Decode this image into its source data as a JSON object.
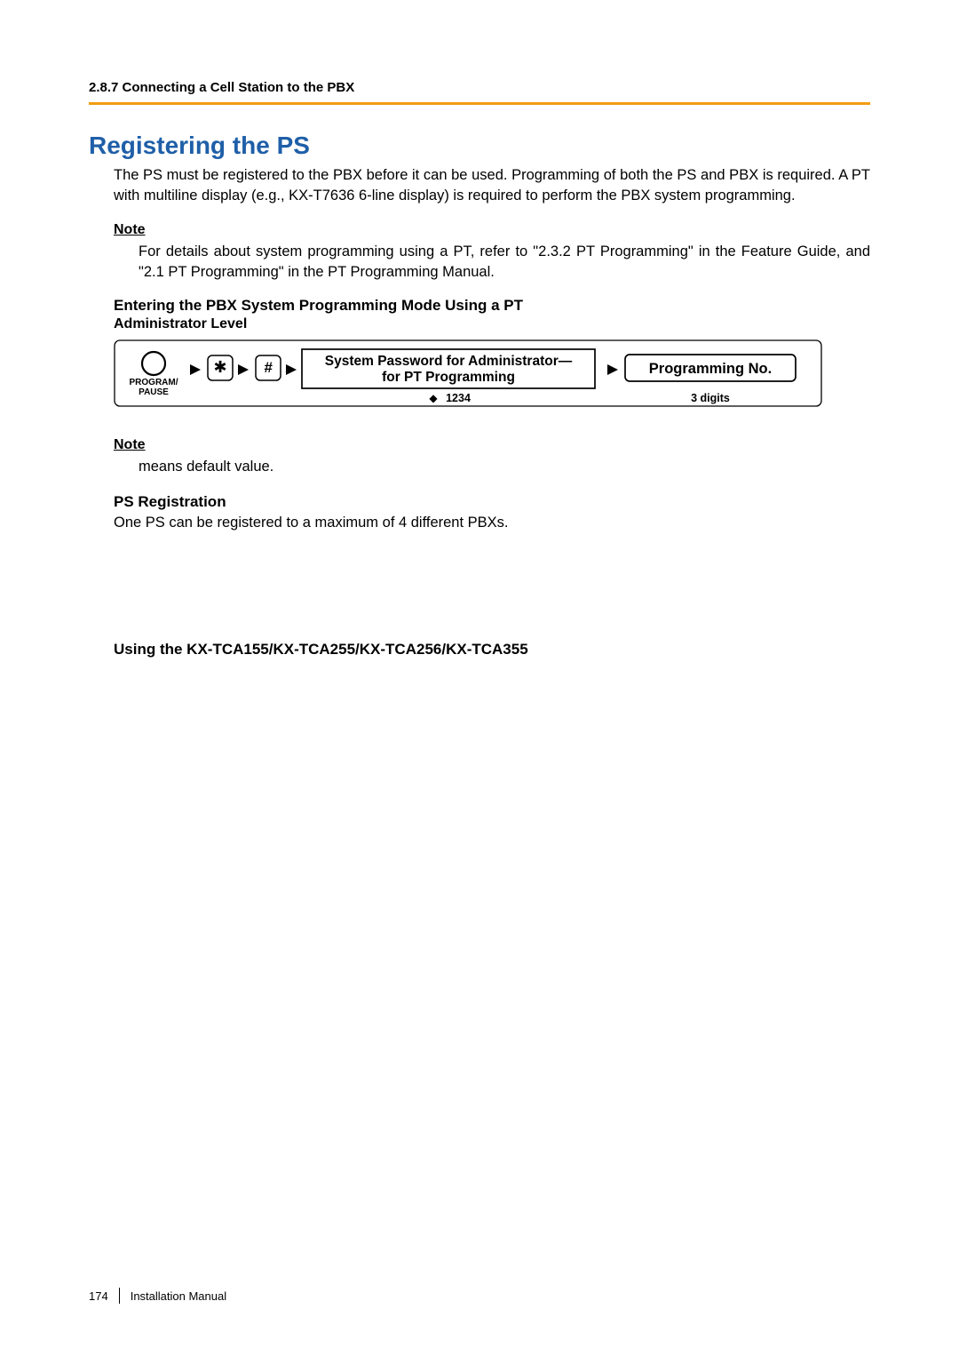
{
  "header": {
    "breadcrumb": "2.8.7 Connecting a Cell Station to the PBX"
  },
  "title": "Registering the PS",
  "intro": [
    "The PS must be registered to the PBX before it can be used. Programming of both the PS and PBX is required. A PT with multiline display (e.g., KX-T7636 6-line display) is required to perform the PBX system programming."
  ],
  "note1": {
    "label": "Note",
    "text": "For details about system programming using a PT, refer to \"2.3.2  PT Programming\" in the Feature Guide, and \"2.1  PT Programming\" in the PT Programming Manual."
  },
  "enter_mode": {
    "heading": "Entering the PBX System Programming Mode Using a PT",
    "level": "Administrator Level"
  },
  "diagram": {
    "program_pause": "PROGRAM/",
    "program_pause2": "PAUSE",
    "star": "✱",
    "hash": "#",
    "password_line1": "System Password for Administrator—",
    "password_line2": "for PT Programming",
    "default_marker": "◆",
    "default_value": "1234",
    "prog_no": "Programming No.",
    "digits": "3 digits"
  },
  "note2": {
    "label": "Note",
    "text": "means default value."
  },
  "ps_reg": {
    "heading": "PS Registration",
    "text": "One PS can be registered to a maximum of 4 different PBXs."
  },
  "using_models": {
    "heading": "Using the KX-TCA155/KX-TCA255/KX-TCA256/KX-TCA355"
  },
  "footer": {
    "page": "174",
    "doc": "Installation Manual"
  }
}
